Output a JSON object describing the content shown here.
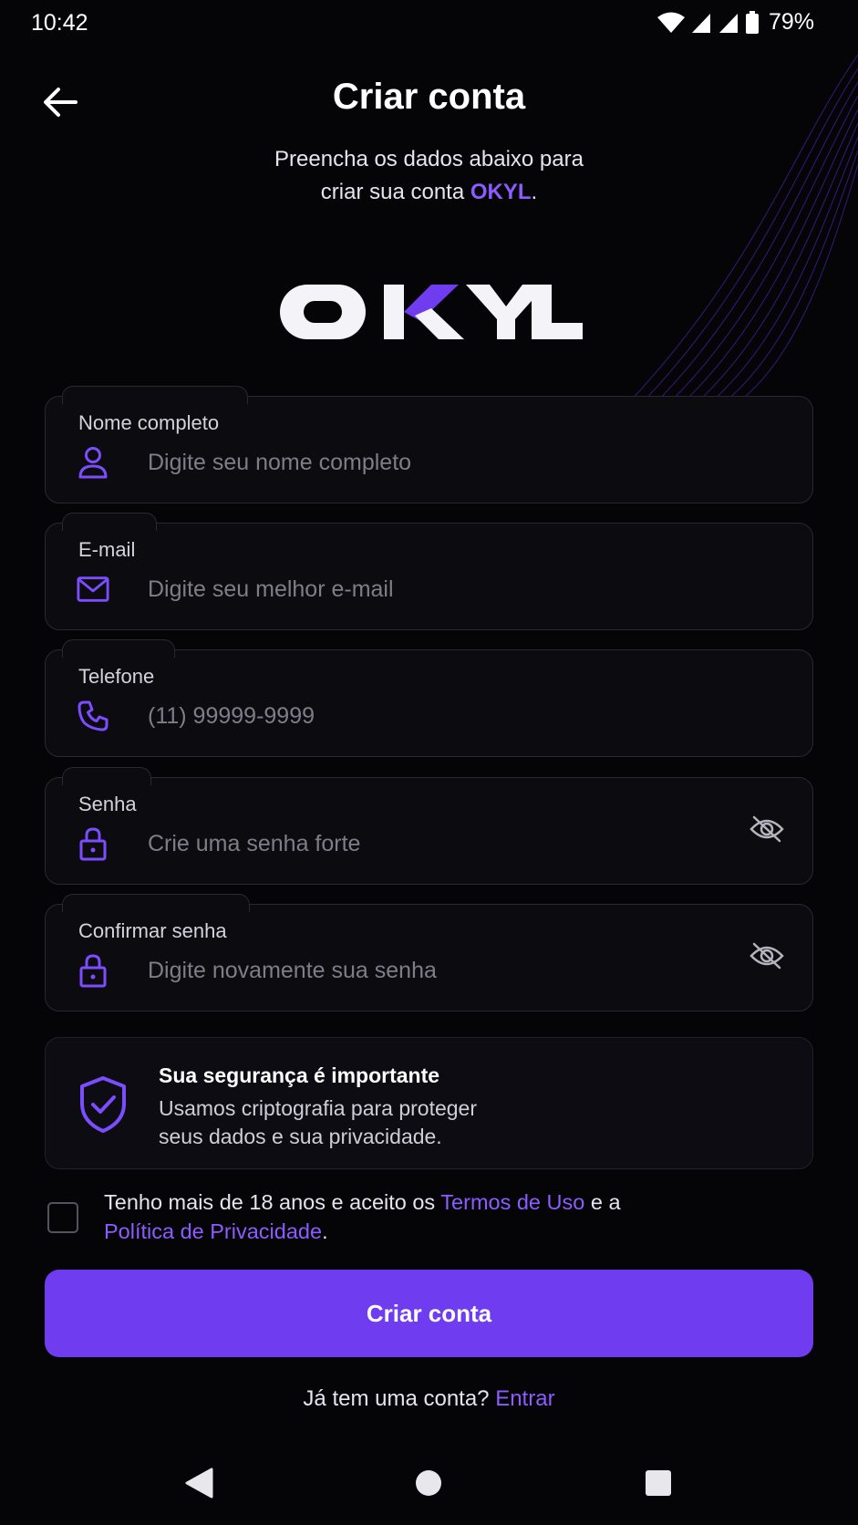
{
  "status_bar": {
    "time": "10:42",
    "battery_percent": "79%",
    "icons": [
      "wifi-icon",
      "signal-icon",
      "signal-icon",
      "battery-icon"
    ]
  },
  "header": {
    "title": "Criar conta",
    "subtitle_line1": "Preencha os dados abaixo para",
    "subtitle_line2_prefix": "criar sua conta ",
    "subtitle_brand": "OKYL",
    "subtitle_line2_suffix": "."
  },
  "logo": {
    "text": "OKYL"
  },
  "form": {
    "full_name": {
      "label": "Nome completo",
      "placeholder": "Digite seu nome completo",
      "value": "",
      "icon": "user-icon"
    },
    "email": {
      "label": "E-mail",
      "placeholder": "Digite seu melhor e-mail",
      "value": "",
      "icon": "mail-icon"
    },
    "phone": {
      "label": "Telefone",
      "placeholder": "(11) 99999-9999",
      "value": "",
      "icon": "phone-icon"
    },
    "password": {
      "label": "Senha",
      "placeholder": "Crie uma senha forte",
      "value": "",
      "icon": "lock-icon",
      "toggle_icon": "eye-off-icon"
    },
    "confirm_password": {
      "label": "Confirmar senha",
      "placeholder": "Digite novamente sua senha",
      "value": "",
      "icon": "lock-icon",
      "toggle_icon": "eye-off-icon"
    }
  },
  "security_notice": {
    "icon": "shield-check-icon",
    "title": "Sua segurança é importante",
    "text_line1": "Usamos criptografia para proteger",
    "text_line2": "seus dados e sua privacidade."
  },
  "terms": {
    "checked": false,
    "prefix": "Tenho mais de 18 anos e aceito os ",
    "terms_link": "Termos de Uso",
    "middle": " e a",
    "privacy_link": "Política de Privacidade",
    "suffix": "."
  },
  "submit_button": {
    "label": "Criar conta"
  },
  "login_prompt": {
    "text": "Já tem uma conta? ",
    "link": "Entrar"
  },
  "nav_bar": {
    "buttons": [
      "back-triangle-icon",
      "home-circle-icon",
      "recents-square-icon"
    ]
  },
  "colors": {
    "background": "#050407",
    "accent": "#6f3cf0",
    "accent_text": "#8c5cff",
    "field_border": "#2a2833"
  }
}
